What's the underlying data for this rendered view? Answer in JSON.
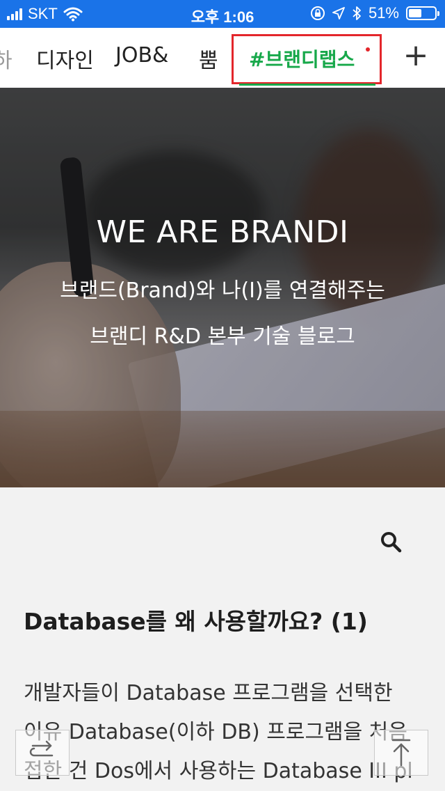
{
  "status_bar": {
    "carrier": "SKT",
    "time": "오후 1:06",
    "battery_percent": "51%",
    "battery_level": 0.51,
    "icons": [
      "signal-icon",
      "wifi-icon",
      "rotation-lock-icon",
      "location-icon",
      "bluetooth-icon",
      "battery-icon"
    ]
  },
  "tabs": {
    "partial": "하",
    "items": [
      "디자인",
      "JOB&",
      "뿜"
    ],
    "active": "#브랜디랩스",
    "active_color": "#17a84a",
    "highlight_color": "#e3262b",
    "add_label": "+"
  },
  "hero": {
    "title": "WE ARE BRANDI",
    "subtitle_line1": "브랜드(Brand)와 나(I)를 연결해주는",
    "subtitle_line2": "브랜디 R&D 본부 기술 블로그"
  },
  "post": {
    "title": "Database를 왜 사용할까요? (1)",
    "excerpt_lines": [
      "개발자들이 Database 프로그램을 선택한",
      "이유 Database(이하 DB) 프로그램을 처음",
      "접한 건 Dos에서 사용하는 Database III pl"
    ]
  },
  "buttons": {
    "share_icon": "share-icon",
    "top_icon": "arrow-up-icon"
  }
}
